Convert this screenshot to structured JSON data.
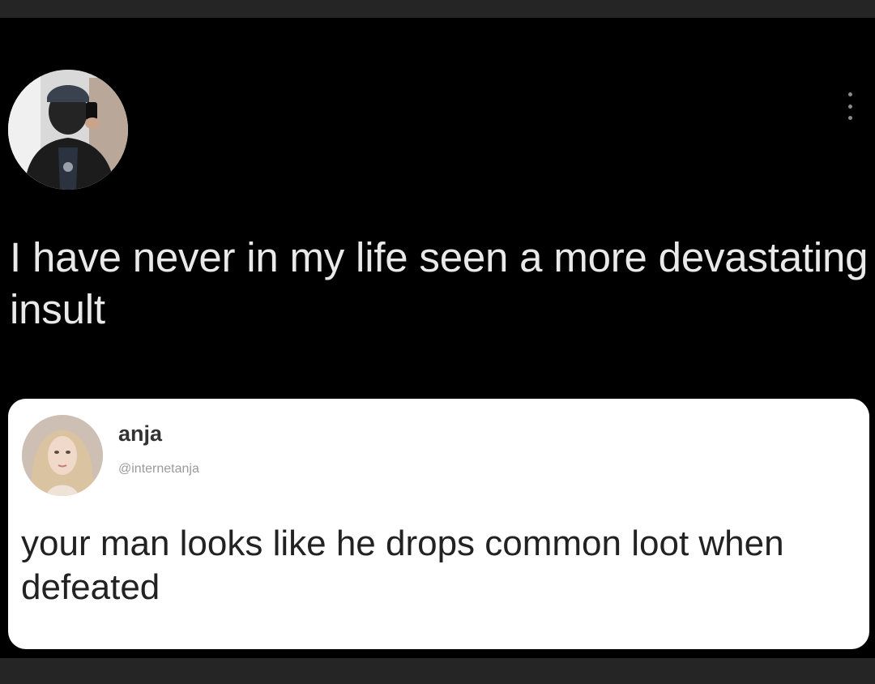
{
  "tweet": {
    "text": "I have never in my life seen a more devastating insult",
    "more_icon": "more-vertical-icon"
  },
  "quoted_tweet": {
    "name": "anja",
    "handle": "@internetanja",
    "text": "your man looks like he drops common loot when defeated"
  }
}
